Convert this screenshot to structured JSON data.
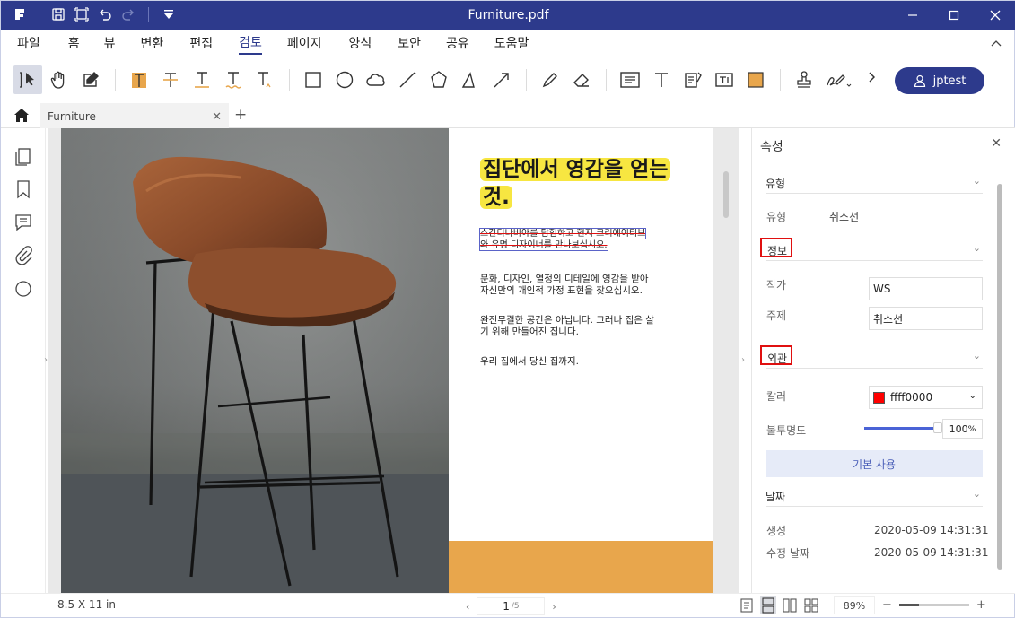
{
  "window": {
    "title": "Furniture.pdf"
  },
  "menu": [
    "파일",
    "홈",
    "뷰",
    "변환",
    "편집",
    "검토",
    "페이지",
    "양식",
    "보안",
    "공유",
    "도움말"
  ],
  "active_menu": "검토",
  "user": {
    "name": "jptest"
  },
  "tab": {
    "label": "Furniture"
  },
  "document": {
    "headline": "집단에서 영감을 얻는것.",
    "struck_text": "스칸디나비아를 탐험하고 현지 크리에이티브와 유명 디자이너를 만나보십시오.",
    "para1": "문화, 디자인, 열정의 디테일에 영감을 받아 자신만의 개인적 가정 표현을 찾으십시오.",
    "para2": "완전무결한 공간은 아닙니다. 그러나 집은 살기 위해 만들어진 집니다.",
    "para3": "우리 집에서 당신 집까지."
  },
  "status": {
    "page_size": "8.5 X 11 in",
    "current_page": "1",
    "total_pages": "/5",
    "zoom": "89%",
    "zoom_level": 0.28
  },
  "panel": {
    "title": "속성",
    "section_type": "유형",
    "type_label": "유형",
    "type_value": "취소선",
    "section_info": "정보",
    "author_label": "작가",
    "author_value": "WS",
    "subject_label": "주제",
    "subject_value": "취소선",
    "section_appearance": "외관",
    "color_label": "칼러",
    "color_value": "ffff0000",
    "color_hex": "#ff0000",
    "opacity_label": "불투명도",
    "opacity_value": "100",
    "opacity_unit": "%",
    "opacity_level": 1.0,
    "default_button": "기본 사용",
    "section_date": "날짜",
    "created_label": "생성",
    "created_value": "2020-05-09 14:31:31",
    "modified_label": "수정 날짜",
    "modified_value": "2020-05-09 14:31:31"
  },
  "colors": {
    "accent": "#2d3a8c",
    "highlight": "#f7e641",
    "orange": "#e8a64c",
    "annotation_box": "#e01010"
  }
}
